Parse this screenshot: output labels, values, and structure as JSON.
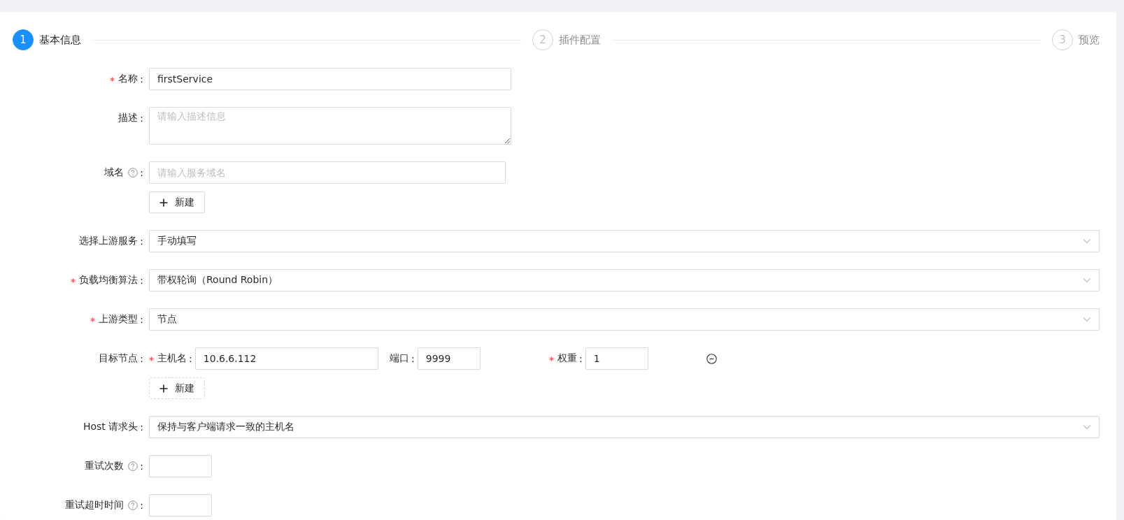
{
  "steps": [
    {
      "number": "1",
      "title": "基本信息",
      "selected": true
    },
    {
      "number": "2",
      "title": "插件配置",
      "selected": false
    },
    {
      "number": "3",
      "title": "预览",
      "selected": false
    }
  ],
  "form": [
    {
      "kind": "input",
      "label": "名称",
      "colon": ":",
      "required": true,
      "help": false,
      "value": "firstService"
    },
    {
      "kind": "textarea",
      "label": "描述",
      "colon": ":",
      "required": false,
      "help": false,
      "placeholder": "请输入描述信息"
    },
    {
      "kind": "dynamic-input",
      "label": "域名",
      "colon": ":",
      "required": false,
      "help": true,
      "placeholder": "请输入服务域名",
      "add_button": "新建"
    },
    {
      "kind": "select",
      "label": "选择上游服务",
      "colon": ":",
      "required": false,
      "help": false,
      "value": "手动填写"
    },
    {
      "kind": "select",
      "label": "负载均衡算法",
      "colon": ":",
      "required": true,
      "help": false,
      "value": "带权轮询（Round Robin）"
    },
    {
      "kind": "select",
      "label": "上游类型",
      "colon": ":",
      "required": true,
      "help": false,
      "value": "节点"
    },
    {
      "kind": "node-list",
      "label": "目标节点",
      "colon": ":",
      "required": false,
      "help": false,
      "nodes": [
        {
          "fields": [
            {
              "kind": "host",
              "label": "主机名",
              "colon": ":",
              "required": true,
              "value": "10.6.6.112"
            },
            {
              "kind": "port",
              "label": "端口",
              "colon": ":",
              "required": false,
              "value": "9999"
            },
            {
              "kind": "weight",
              "label": "权重",
              "colon": ":",
              "required": true,
              "value": "1"
            }
          ]
        }
      ],
      "add_button": "新建"
    },
    {
      "kind": "select",
      "label": "Host 请求头",
      "colon": ":",
      "required": false,
      "help": false,
      "value": "保持与客户端请求一致的主机名"
    },
    {
      "kind": "number",
      "label": "重试次数",
      "colon": ":",
      "required": false,
      "help": true
    },
    {
      "kind": "number",
      "label": "重试超时时间",
      "colon": ":",
      "required": false,
      "help": true
    }
  ]
}
